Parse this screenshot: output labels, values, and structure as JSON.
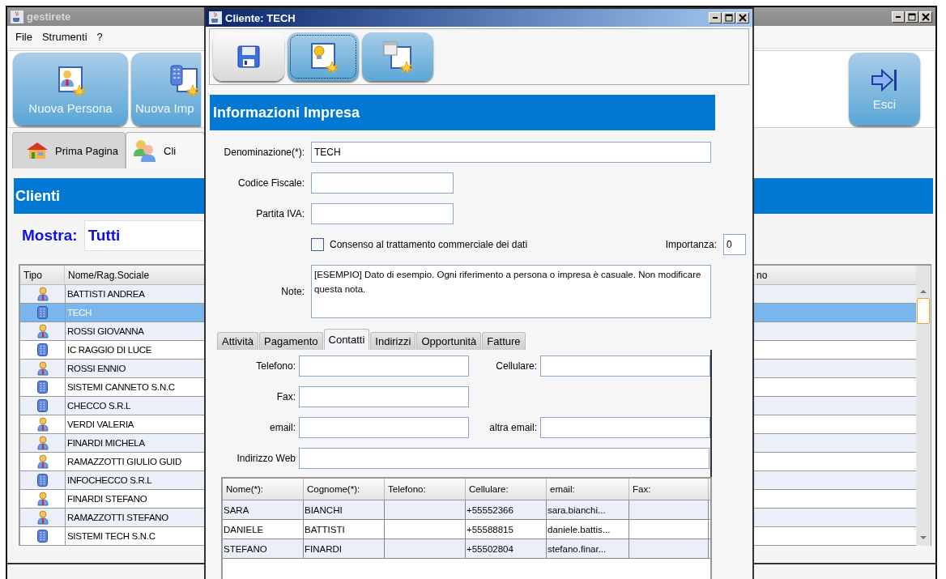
{
  "main_window": {
    "title": "gestirete",
    "menu": [
      "File",
      "Strumenti",
      "?"
    ],
    "toolbar": [
      {
        "kind": "person",
        "label": "Nuova Persona"
      },
      {
        "kind": "company",
        "label": "Nuova Imp"
      }
    ],
    "exit_button": {
      "label": "Esci"
    },
    "tabs": [
      {
        "kind": "home",
        "label": "Prima Pagina",
        "selected": false
      },
      {
        "kind": "clients",
        "label": "Cli",
        "selected": true
      }
    ],
    "section_title": "Clienti",
    "filter": {
      "label": "Mostra:",
      "value": "Tutti"
    },
    "table": {
      "columns": [
        "Tipo",
        "Nome/Rag.Sociale",
        "no"
      ],
      "rows": [
        {
          "kind": "person",
          "name": "BATTISTI ANDREA",
          "selected": false
        },
        {
          "kind": "company",
          "name": "TECH",
          "selected": true
        },
        {
          "kind": "person",
          "name": "ROSSI GIOVANNA",
          "selected": false
        },
        {
          "kind": "company",
          "name": "IC RAGGIO DI LUCE",
          "selected": false
        },
        {
          "kind": "person",
          "name": "ROSSI ENNIO",
          "selected": false
        },
        {
          "kind": "company",
          "name": "SISTEMI CANNETO S.N.C",
          "selected": false
        },
        {
          "kind": "company",
          "name": "CHECCO S.R.L",
          "selected": false
        },
        {
          "kind": "person",
          "name": "VERDI VALERIA",
          "selected": false
        },
        {
          "kind": "person",
          "name": "FINARDI MICHELA",
          "selected": false
        },
        {
          "kind": "person",
          "name": "RAMAZZOTTI GIULIO GUID",
          "selected": false
        },
        {
          "kind": "company",
          "name": "INFOCHECCO S.R.L",
          "selected": false
        },
        {
          "kind": "person",
          "name": "FINARDI STEFANO",
          "selected": false
        },
        {
          "kind": "person",
          "name": "RAMAZZOTTI STEFANO",
          "selected": false
        },
        {
          "kind": "company",
          "name": "SISTEMI TECH S.N.C",
          "selected": false
        }
      ]
    }
  },
  "dialog": {
    "title": "Cliente: TECH",
    "toolbar": [
      {
        "kind": "save",
        "focused": false
      },
      {
        "kind": "idea",
        "focused": true
      },
      {
        "kind": "window",
        "focused": false
      }
    ],
    "section_title": "Informazioni Impresa",
    "fields": [
      {
        "label": "Denominazione(*):",
        "value": "TECH",
        "wide": true
      },
      {
        "label": "Codice Fiscale:",
        "wide": false
      },
      {
        "label": "Partita IVA:",
        "wide": false
      }
    ],
    "consent": {
      "label": "Consenso al trattamento commerciale dei dati",
      "checked": false
    },
    "importance": {
      "label": "Importanza:",
      "value": "0"
    },
    "note": {
      "label": "Note:",
      "value": "[ESEMPIO] Dato di esempio. Ogni riferimento a persona o impresa è casuale. Non modificare questa nota."
    },
    "tabs": [
      {
        "label": "Attività",
        "selected": false
      },
      {
        "label": "Pagamento",
        "selected": false
      },
      {
        "label": "Contatti",
        "selected": true
      },
      {
        "label": "Indirizzi",
        "selected": false
      },
      {
        "label": "Opportunità",
        "selected": false
      },
      {
        "label": "Fatture",
        "selected": false
      }
    ],
    "contact_fields": [
      {
        "label": "Telefono:"
      },
      {
        "label": "Cellulare:"
      },
      {
        "label": "Fax:"
      },
      {
        "label": "email:"
      },
      {
        "label": "altra email:"
      },
      {
        "label": "Indirizzo Web"
      }
    ],
    "contacts": {
      "columns": [
        "Nome(*):",
        "Cognome(*):",
        "Telefono:",
        "Cellulare:",
        "email:",
        "Fax:"
      ],
      "rows": [
        [
          "SARA",
          "BIANCHI",
          "",
          "+55552366",
          "sara.bianchi...",
          ""
        ],
        [
          "DANIELE",
          "BATTISTI",
          "",
          "+55588815",
          "daniele.battis...",
          ""
        ],
        [
          "STEFANO",
          "FINARDI",
          "",
          "+55502804",
          "stefano.finar...",
          ""
        ]
      ]
    }
  }
}
